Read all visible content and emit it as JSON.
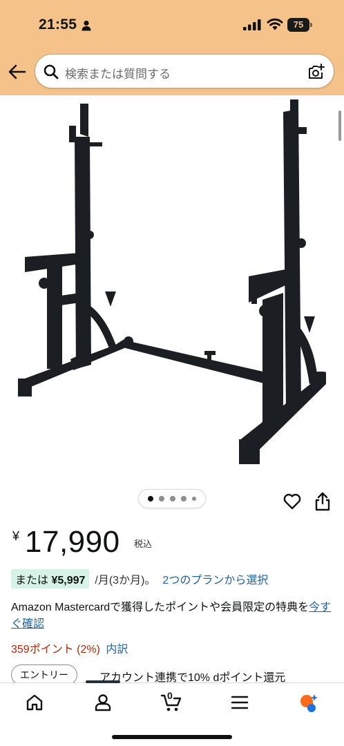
{
  "status_bar": {
    "time": "21:55",
    "battery": "75",
    "battery_level_percent": 75
  },
  "search": {
    "placeholder": "検索または質問する"
  },
  "product_image": {
    "alt": "バーベルラック",
    "dots_total": 5,
    "active_dot": 1
  },
  "price": {
    "symbol": "¥",
    "amount": "17,990",
    "tax": "税込"
  },
  "installment": {
    "prefix": "または",
    "amount": "¥5,997",
    "term": "/月(3か月)。",
    "link": "2つのプランから選択"
  },
  "promo": {
    "text": "Amazon Mastercardで獲得したポイントや会員限定の特典を",
    "link": "今すぐ確認"
  },
  "points": {
    "value": "359ポイント (2%)",
    "detail": "内訳"
  },
  "entry": {
    "button": "エントリー",
    "text": "アカウント連携で10% dポイント還元"
  },
  "bottom_nav": {
    "cart_count": "0",
    "items": [
      "home-icon",
      "account-icon",
      "cart-icon",
      "menu-icon",
      "rufus-icon"
    ]
  },
  "colors": {
    "header": "#f5c28a",
    "link": "#2162a1",
    "points": "#b12704",
    "badge": "#d6f3e6"
  }
}
